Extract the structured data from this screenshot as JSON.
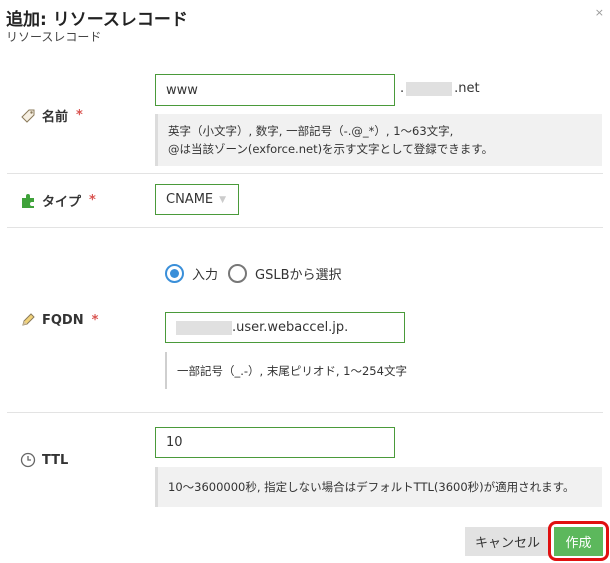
{
  "dialog": {
    "title": "追加: リソースレコード",
    "subtitle": "リソースレコード"
  },
  "name_field": {
    "label": "名前",
    "required_mark": "*",
    "value": "www",
    "domain_prefix": ".",
    "domain_suffix": ".net",
    "help_line1": "英字（小文字）, 数字, 一部記号（-.@_*）, 1〜63文字,",
    "help_line2": "@は当該ゾーン(exforce.net)を示す文字として登録できます。"
  },
  "type_field": {
    "label": "タイプ",
    "required_mark": "*",
    "selected": "CNAME"
  },
  "fqdn_field": {
    "label": "FQDN",
    "required_mark": "*",
    "radio_input_label": "入力",
    "radio_gslb_label": "GSLBから選択",
    "value_suffix": ".user.webaccel.jp.",
    "help": "一部記号（_.-）, 末尾ピリオド, 1〜254文字"
  },
  "ttl_field": {
    "label": "TTL",
    "value": "10",
    "help": "10〜3600000秒, 指定しない場合はデフォルトTTL(3600秒)が適用されます。"
  },
  "buttons": {
    "cancel": "キャンセル",
    "create": "作成"
  },
  "colors": {
    "accent_green": "#5cb85c",
    "input_border": "#4a9a3a",
    "required": "#d9534f",
    "radio_selected": "#3a8fd9",
    "highlight": "#e01010"
  }
}
